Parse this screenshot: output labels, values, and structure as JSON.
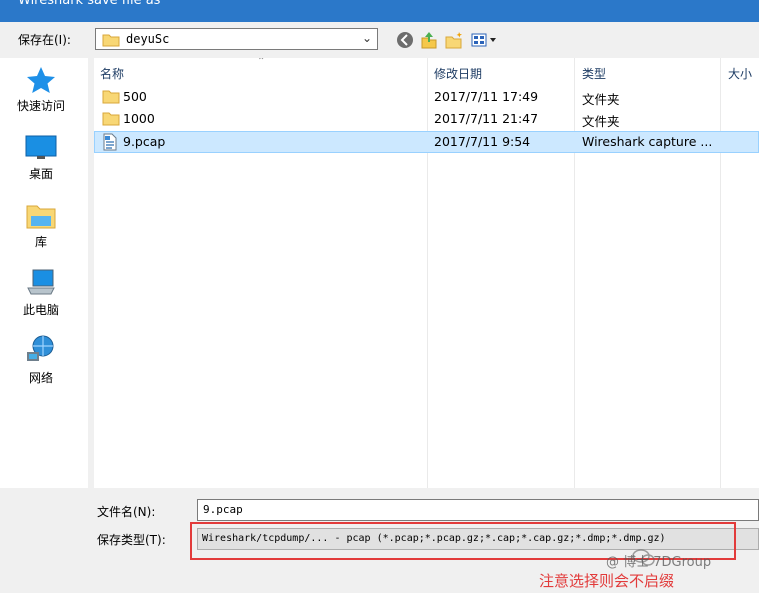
{
  "window": {
    "title": "Wireshark save file as"
  },
  "toolbar": {
    "save_in_label": "保存在(I):",
    "location": "deyuSc"
  },
  "sidebar": {
    "items": [
      {
        "label": "快速访问",
        "icon": "star-icon"
      },
      {
        "label": "桌面",
        "icon": "desktop-icon"
      },
      {
        "label": "库",
        "icon": "library-icon"
      },
      {
        "label": "此电脑",
        "icon": "computer-icon"
      },
      {
        "label": "网络",
        "icon": "network-icon"
      }
    ]
  },
  "filelist": {
    "columns": [
      "名称",
      "修改日期",
      "类型",
      "大小"
    ],
    "rows": [
      {
        "name": "500",
        "date": "2017/7/11 17:49",
        "type": "文件夹",
        "icon": "folder-icon"
      },
      {
        "name": "1000",
        "date": "2017/7/11 21:47",
        "type": "文件夹",
        "icon": "folder-icon"
      },
      {
        "name": "9.pcap",
        "date": "2017/7/11 9:54",
        "type": "Wireshark capture ...",
        "icon": "pcap-file-icon",
        "selected": true
      }
    ]
  },
  "form": {
    "filename_label": "文件名(N):",
    "filename_value": "9.pcap",
    "filetype_label": "保存类型(T):",
    "filetype_value": "Wireshark/tcpdump/... - pcap (*.pcap;*.pcap.gz;*.cap;*.cap.gz;*.dmp;*.dmp.gz)"
  },
  "annotation": {
    "text": "注意选择则会不启缀"
  },
  "watermark": {
    "text": "@ 博士 7DGroup"
  },
  "colors": {
    "accent": "#2b78c9",
    "selection": "#cce8ff",
    "annotation": "#e23b3b"
  }
}
